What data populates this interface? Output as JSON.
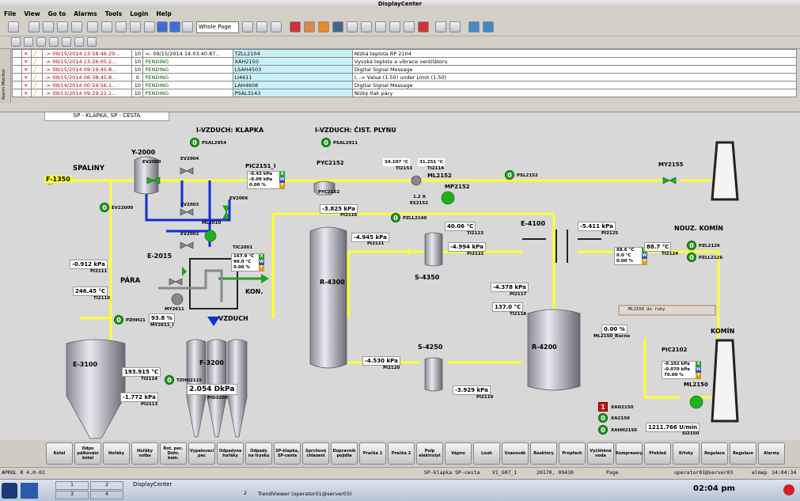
{
  "window_title": "DisplayCenter",
  "menu": [
    "File",
    "View",
    "Go to",
    "Alarms",
    "Tools",
    "Login",
    "Help"
  ],
  "toolbar": {
    "page_select": "Whole Page"
  },
  "alarm_monitor_label": "Alarm Monitor",
  "alarms": [
    {
      "time": "-> 09/15/2014 13:58:46.29...",
      "prio": "10",
      "state": "<- 09/15/2014 14:03:40.87...",
      "tag": "TZLL2104",
      "text": "Nízká teplota RP 2104"
    },
    {
      "time": "-> 09/15/2014 13:26:05.2...",
      "prio": "10",
      "state": "PENDING",
      "tag": "XAH2150",
      "text": "Vysoká teplota a vibrace ventilátoru"
    },
    {
      "time": "-> 09/15/2014 09:19:45.8...",
      "prio": "10",
      "state": "PENDING",
      "tag": "LSAH4503",
      "text": "Digital Signal Message"
    },
    {
      "time": "-> 09/15/2014 06:38:45.8...",
      "prio": "0",
      "state": "PENDING",
      "tag": "LI4611",
      "text": "I, -> Value (1.50) under Limit (1.50)"
    },
    {
      "time": "-> 09/14/2014 00:54:56.1...",
      "prio": "10",
      "state": "PENDING",
      "tag": "LAH4608",
      "text": "Digital Signal Message"
    },
    {
      "time": "-> 09/13/2014 09:29:22.1...",
      "prio": "10",
      "state": "PENDING",
      "tag": "PSAL3143",
      "text": "Nízký tlak páry"
    }
  ],
  "process": {
    "tab": "SP - KLAPKA, SP - CESTA",
    "labels": {
      "ivzduch_klapka": "I-VZDUCH: KLAPKA",
      "ivzduch_cist": "I-VZDUCH: ČIST. PLYNU",
      "spaliny": "SPALINY",
      "f1350": "F-1350",
      "y2000": "Y-2000",
      "ev2000": "EV2000",
      "ev2004": "EV2004",
      "ev2003": "EV2003",
      "ev2002": "EV2002",
      "ev2006": "EV2006",
      "ev22000": "EV22000",
      "e2015": "E-2015",
      "para": "PÁRA",
      "kon": "KON.",
      "vzduch": "VZDUCH",
      "r4300": "R-4300",
      "s4350": "S-4350",
      "s4250": "S-4250",
      "r4200": "R-4200",
      "e4100": "E-4100",
      "e3100": "E-3100",
      "f3200": "F-3200",
      "my2155": "MY2155",
      "nouz_komin": "NOUZ. KOMÍN",
      "komin": "KOMÍN",
      "ml2150": "ML2150",
      "ml2152": "ML2152",
      "mp2152": "MP2152",
      "pyc2152": "PYC2152",
      "pyc2152b": "PYC2152",
      "pic2151": "PIC2151_I",
      "pic2102": "PIC2102",
      "tic2001": "TIC2001",
      "ml2010": "ML2010",
      "my2611": "MY2611",
      "ml2150_doruky": "ML2150 do ruky"
    },
    "values": {
      "pi2111": "-0.912 kPa",
      "ti2110": "246.45 °C",
      "my2611": "93.8 %",
      "ti2114": "193.915 °C",
      "pi2113": "-1.772 kPa",
      "pid3205": "2.054 DkPa",
      "pi2116": "-3.825 kPa",
      "pi2121": "-4.945 kPa",
      "ti2123": "40.06 °C",
      "pi2122": "-4.994 kPa",
      "pi2117": "-4.378 kPa",
      "ti2118": "137.0 °C",
      "pi2125": "-5.411 kPa",
      "ti2124": "88.7 °C",
      "pi2120": "-4.530 kPa",
      "pi2119": "-3.929 kPa",
      "ml2150_rucne": "0.00 %",
      "si2150": "1211.766 U/min",
      "ti2153": "34.107 °C",
      "ti2154": "31.251 °C",
      "es2152": "1.2 A"
    },
    "tags": {
      "pi2111": "PI2111",
      "ti2110": "TI2110",
      "my2611": "MY2611_I",
      "ti2114": "TI2114",
      "pi2113": "PI2113",
      "pid3205": "PID3205",
      "pi2116": "PI2116",
      "pi2121": "PI2121",
      "ti2123": "TI2123",
      "pi2122": "PI2122",
      "pi2117": "PI2117",
      "ti2118": "TI2118",
      "pi2125": "PI2125",
      "ti2124": "TI2124",
      "pi2120": "PI2120",
      "pi2119": "PI2119",
      "ml2150_rucne": "ML2150_Rucne",
      "si2150": "SI2150",
      "ti2153": "TI2153",
      "ti2154": "TI2114",
      "es2152": "ES2152",
      "psal2954": "PSAL2954",
      "psal2911": "PSAL2911",
      "psl2152": "PSL2152",
      "pzll2140": "PZLL2140",
      "pzl2126": "PZL2126",
      "pzll2126": "PZLL2126",
      "pzhh21": "PZHH21",
      "tzhh2115": "TZHH2115",
      "xah2150": "XAH2150",
      "xa2150": "XA2150",
      "xahh2150": "XAHH2150"
    },
    "pic2151_box": [
      "-0.43 kPa",
      "-0.09 kPa",
      "0.00 %"
    ],
    "tic2001_box": [
      "167.9 °C",
      "90.0 °C",
      "0.00 %"
    ],
    "pi2125_box": [
      "88.6 °C",
      "0.0 °C",
      "0.00 %"
    ],
    "pic2102_box": [
      "-0.102 kPa",
      "-0.070 kPa",
      "70.00 %"
    ],
    "box_letters": [
      "X",
      "W",
      "Y"
    ],
    "ind_zero": "0",
    "ind_one": "1"
  },
  "buttons": [
    "Kotel",
    "Odpo pálkování kotel",
    "Hořáky",
    "Hořáky volba",
    "Rot. pec. Dohr. kom.",
    "Vypalovací pec",
    "Odpadyna hořáky",
    "Odpady na trysku",
    "SP-klapka, SP-cesta",
    "Sprchové chlazení",
    "Dopravník pojidla",
    "Pračka 1",
    "Pračka 2",
    "Pulp elektrolyt",
    "Vápno",
    "Louh",
    "Usazovák",
    "Reaktory",
    "Propfach",
    "Vyčištěná voda",
    "Kompresory",
    "Přehled",
    "Křivky",
    "Regulace",
    "Regulace",
    "Alarmy"
  ],
  "status": {
    "version": "APROL R 4.0-01",
    "page": "SP-klapka SP-cesta",
    "server": "V1_G07_1",
    "coords": "20170, 09430",
    "page_btn": "Page",
    "user": "operator01@server03",
    "short": "elmep",
    "clock": "14:04:34"
  },
  "taskbar": {
    "app": "DisplayCenter",
    "trend": "TrendViewer (operator01@server03)",
    "time": "02:04 pm",
    "trend_num": "2",
    "desk": [
      "1",
      "2",
      "3",
      "4"
    ]
  }
}
